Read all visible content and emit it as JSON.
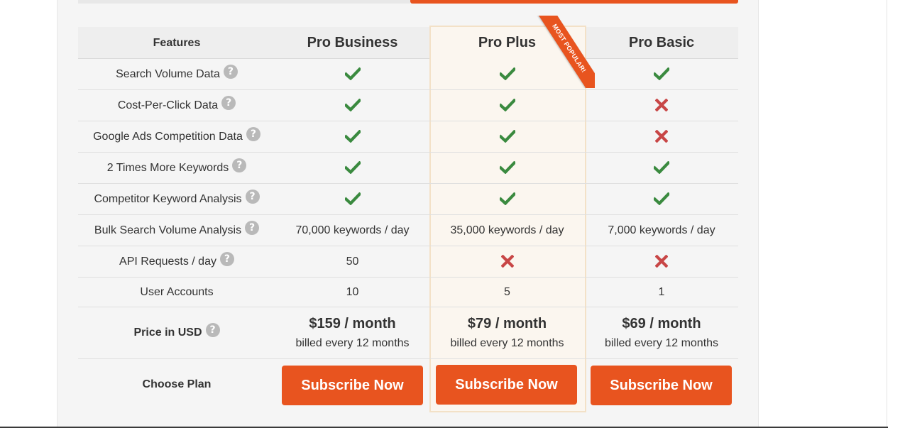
{
  "colors": {
    "accent": "#e8541f",
    "check": "#3a8a3f",
    "cross": "#c84646",
    "highlight_bg": "#fbf6ef",
    "highlight_border": "#f3e1c7"
  },
  "header": {
    "features_label": "Features",
    "plans": [
      "Pro Business",
      "Pro Plus",
      "Pro Basic"
    ],
    "ribbon_text": "MOST POPULAR!"
  },
  "rows": [
    {
      "feature": "Search Volume Data",
      "help_icon": "question-circle-icon",
      "values": [
        "check",
        "check",
        "check"
      ]
    },
    {
      "feature": "Cost-Per-Click Data",
      "help_icon": "question-circle-icon",
      "values": [
        "check",
        "check",
        "cross"
      ]
    },
    {
      "feature": "Google Ads Competition Data",
      "help_icon": "question-circle-icon",
      "values": [
        "check",
        "check",
        "cross"
      ]
    },
    {
      "feature": "2 Times More Keywords",
      "help_icon": "question-circle-icon",
      "values": [
        "check",
        "check",
        "check"
      ]
    },
    {
      "feature": "Competitor Keyword Analysis",
      "help_icon": "question-circle-icon",
      "values": [
        "check",
        "check",
        "check"
      ]
    },
    {
      "feature": "Bulk Search Volume Analysis",
      "help_icon": "question-circle-icon",
      "values": [
        "70,000 keywords / day",
        "35,000 keywords / day",
        "7,000 keywords / day"
      ]
    },
    {
      "feature": "API Requests / day",
      "help_icon": "question-circle-icon",
      "values": [
        "50",
        "cross",
        "cross"
      ]
    },
    {
      "feature": "User Accounts",
      "help_icon": "",
      "values": [
        "10",
        "5",
        "1"
      ]
    }
  ],
  "pricing": {
    "label": "Price in USD",
    "help_glyph": "?",
    "prices": [
      "$159 / month",
      "$79 / month",
      "$69 / month"
    ],
    "billing": [
      "billed every 12 months",
      "billed every 12 months",
      "billed every 12 months"
    ]
  },
  "choose": {
    "label": "Choose Plan",
    "buttons": [
      "Subscribe Now",
      "Subscribe Now",
      "Subscribe Now"
    ]
  }
}
